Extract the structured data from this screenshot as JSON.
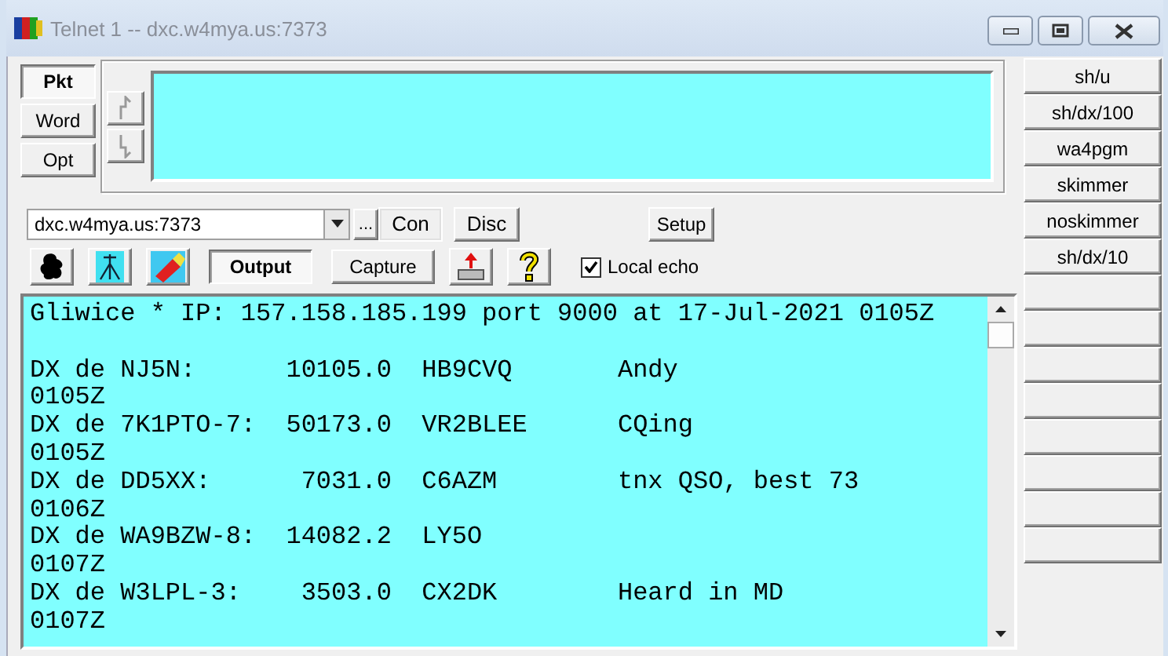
{
  "window": {
    "title": "Telnet 1 -- dxc.w4mya.us:7373",
    "controls": [
      {
        "kind": "minimize"
      },
      {
        "kind": "maximize"
      },
      {
        "kind": "close"
      }
    ]
  },
  "mode_buttons": [
    {
      "label": "Pkt",
      "selected": true
    },
    {
      "label": "Word",
      "selected": false
    },
    {
      "label": "Opt",
      "selected": false
    }
  ],
  "connection": {
    "host": "dxc.w4mya.us:7373",
    "browse": "...",
    "connect": "Con",
    "disconnect": "Disc",
    "setup": "Setup"
  },
  "toolbar": [
    {
      "kind": "blob"
    },
    {
      "kind": "antenna"
    },
    {
      "kind": "eraser"
    },
    {
      "kind": "text",
      "label": "Output",
      "selected": true
    },
    {
      "kind": "text",
      "label": "Capture",
      "selected": false
    },
    {
      "kind": "upload"
    },
    {
      "kind": "help"
    }
  ],
  "local_echo": {
    "label": "Local echo",
    "checked": true
  },
  "terminal": [
    "Gliwice * IP: 157.158.185.199 port 9000 at 17-Jul-2021 0105Z",
    "DX de NJ5N:      10105.0  HB9CVQ       Andy",
    "0105Z",
    "DX de 7K1PTO-7:  50173.0  VR2BLEE      CQing",
    "0105Z",
    "DX de DD5XX:      7031.0  C6AZM        tnx QSO, best 73",
    "0106Z",
    "DX de WA9BZW-8:  14082.2  LY5O",
    "0107Z",
    "DX de W3LPL-3:    3503.0  CX2DK        Heard in MD",
    "0107Z"
  ],
  "terminal_blank_after_first": true,
  "macros": [
    "sh/u",
    "sh/dx/100",
    "wa4pgm",
    "skimmer",
    "noskimmer",
    "sh/dx/10"
  ]
}
